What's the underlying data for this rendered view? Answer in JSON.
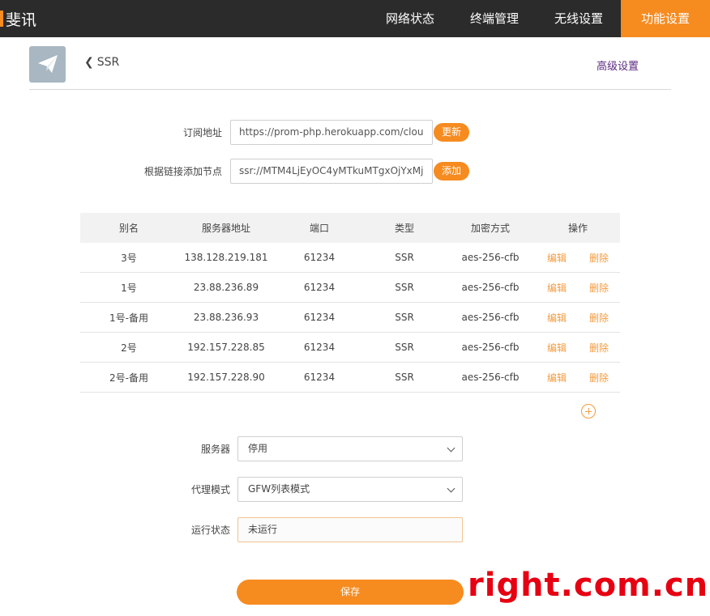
{
  "brand": {
    "name": "斐讯"
  },
  "nav": {
    "items": [
      {
        "label": "网络状态"
      },
      {
        "label": "终端管理"
      },
      {
        "label": "无线设置"
      },
      {
        "label": "功能设置"
      }
    ]
  },
  "header": {
    "back_label": "SSR",
    "advanced_label": "高级设置"
  },
  "subscription": {
    "label": "订阅地址",
    "value": "https://prom-php.herokuapp.com/clou",
    "button": "更新"
  },
  "add_node": {
    "label": "根据链接添加节点",
    "value": "ssr://MTM4LjEyOC4yMTkuMTgxOjYxMj",
    "button": "添加"
  },
  "table": {
    "headers": [
      "别名",
      "服务器地址",
      "端口",
      "类型",
      "加密方式",
      "操作"
    ],
    "rows": [
      {
        "alias": "3号",
        "server": "138.128.219.181",
        "port": "61234",
        "type": "SSR",
        "cipher": "aes-256-cfb"
      },
      {
        "alias": "1号",
        "server": "23.88.236.89",
        "port": "61234",
        "type": "SSR",
        "cipher": "aes-256-cfb"
      },
      {
        "alias": "1号-备用",
        "server": "23.88.236.93",
        "port": "61234",
        "type": "SSR",
        "cipher": "aes-256-cfb"
      },
      {
        "alias": "2号",
        "server": "192.157.228.85",
        "port": "61234",
        "type": "SSR",
        "cipher": "aes-256-cfb"
      },
      {
        "alias": "2号-备用",
        "server": "192.157.228.90",
        "port": "61234",
        "type": "SSR",
        "cipher": "aes-256-cfb"
      }
    ],
    "edit_label": "编辑",
    "delete_label": "删除"
  },
  "form": {
    "server": {
      "label": "服务器",
      "value": "停用"
    },
    "proxy_mode": {
      "label": "代理模式",
      "value": "GFW列表模式"
    },
    "run_status": {
      "label": "运行状态",
      "value": "未运行"
    }
  },
  "save_label": "保存",
  "watermark": {
    "text": "right.com.cn"
  },
  "colors": {
    "accent": "#f68b1f",
    "topbar": "#2b2b2b",
    "link": "#5a2a82",
    "watermark": "#e60012"
  },
  "icons": {
    "plugin_logo": "paper-plane-icon",
    "back": "chevron-left-icon",
    "add": "plus-circle-icon",
    "dropdown": "chevron-down-icon"
  }
}
